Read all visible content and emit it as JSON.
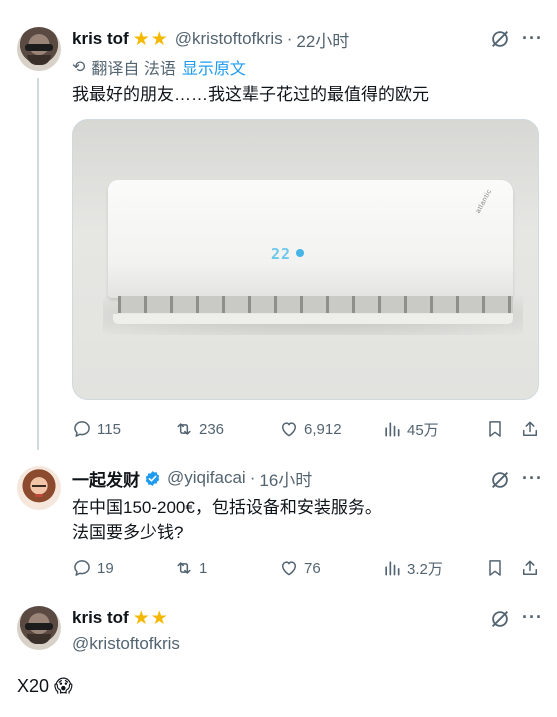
{
  "tweet1": {
    "name": "kris tof",
    "stars": "★★",
    "handle": "@kristoftofkris",
    "separator": "·",
    "time": "22小时",
    "more": "···",
    "translate_label": "翻译自 法语",
    "show_original": "显示原文",
    "text": "我最好的朋友……我这辈子花过的最值得的欧元",
    "photo_display_value": "22",
    "photo_brand": "atlantic",
    "replies": "115",
    "retweets": "236",
    "likes": "6,912",
    "views": "45万"
  },
  "tweet2": {
    "name": "一起发财",
    "handle": "@yiqifacai",
    "separator": "·",
    "time": "16小时",
    "more": "···",
    "text_line1": "在中国150-200€，包括设备和安装服务。",
    "text_line2": "法国要多少钱?",
    "replies": "19",
    "retweets": "1",
    "likes": "76",
    "views": "3.2万"
  },
  "tweet3": {
    "name": "kris tof",
    "stars": "★★",
    "handle": "@kristoftofkris",
    "more": "···",
    "text": "X20 😱"
  },
  "colors": {
    "text": "#0f1419",
    "secondary": "#536471",
    "link": "#1d9bf0",
    "verified": "#1d9bf0",
    "star": "#f5b800",
    "divider": "#cfd9de"
  }
}
